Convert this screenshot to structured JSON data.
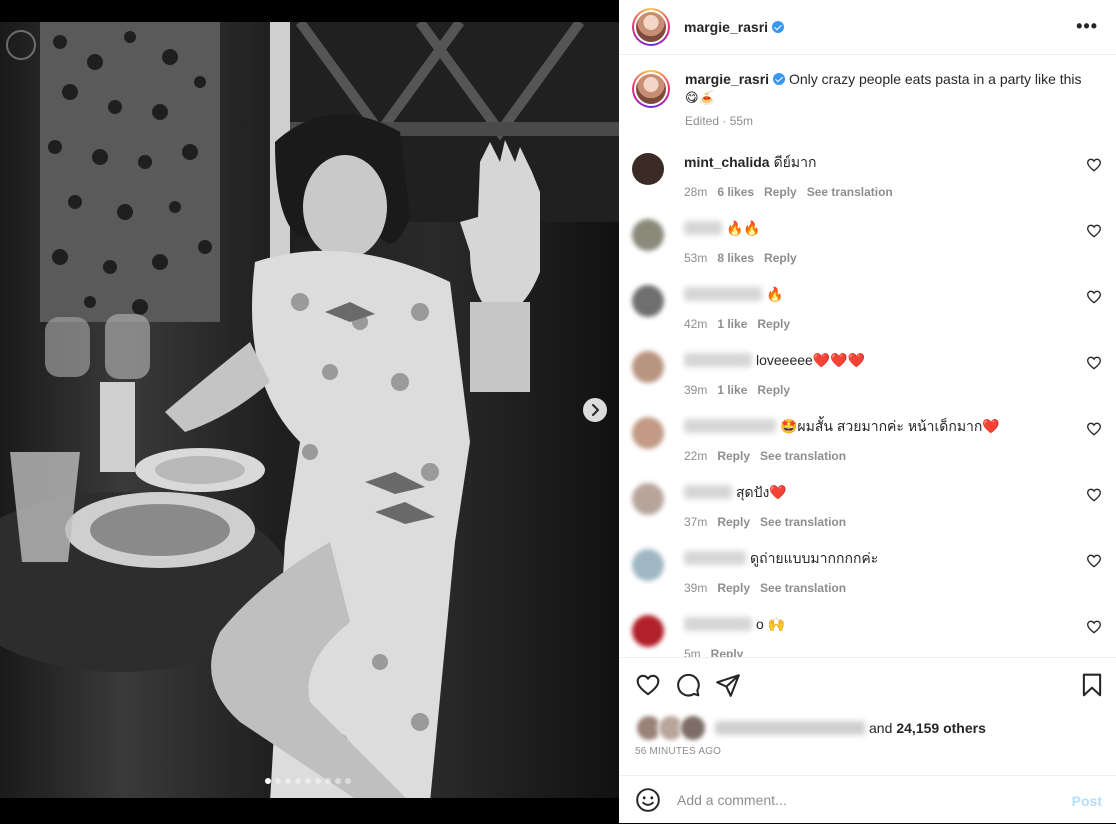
{
  "post": {
    "author": "margie_rasri",
    "caption": "Only crazy people eats pasta in a party like this",
    "caption_emoji": "😋🍝",
    "edited": "Edited · 55m"
  },
  "comments": [
    {
      "user": "mint_chalida",
      "text": "ดีย์มาก",
      "time": "28m",
      "likes": "6 likes",
      "reply": "Reply",
      "translate": "See translation",
      "blur": false,
      "av": "#3b2a25"
    },
    {
      "user": "",
      "text": "🔥🔥",
      "time": "53m",
      "likes": "8 likes",
      "reply": "Reply",
      "translate": "",
      "blur": true,
      "av": "#8a8a7a"
    },
    {
      "user": "",
      "text": "🔥",
      "time": "42m",
      "likes": "1 like",
      "reply": "Reply",
      "translate": "",
      "blur": true,
      "av": "#6f6f6f"
    },
    {
      "user": "",
      "text": "loveeeee❤️❤️❤️",
      "time": "39m",
      "likes": "1 like",
      "reply": "Reply",
      "translate": "",
      "blur": true,
      "av": "#b89581"
    },
    {
      "user": "",
      "text": "🤩ผมสั้น สวยมากค่ะ หน้าเด็กมาก❤️",
      "time": "22m",
      "likes": "",
      "reply": "Reply",
      "translate": "See translation",
      "blur": true,
      "av": "#c29a85"
    },
    {
      "user": "",
      "text": "สุดปัง❤️",
      "time": "37m",
      "likes": "",
      "reply": "Reply",
      "translate": "See translation",
      "blur": true,
      "av": "#b7a59b"
    },
    {
      "user": "",
      "text": "ดูถ่ายแบบมากกกกค่ะ",
      "time": "39m",
      "likes": "",
      "reply": "Reply",
      "translate": "See translation",
      "blur": true,
      "av": "#9fb8c4"
    },
    {
      "user": "",
      "text": "o 🙌",
      "time": "5m",
      "likes": "",
      "reply": "Reply",
      "translate": "",
      "blur": true,
      "av": "#b2202a"
    }
  ],
  "likes_summary": {
    "prefix": "and",
    "count": "24,159 others"
  },
  "timestamp": "56 MINUTES AGO",
  "composer": {
    "placeholder": "Add a comment...",
    "post_label": "Post"
  },
  "carousel": {
    "slides": 9,
    "active": 0
  },
  "icons": {
    "more": "more-horizontal-icon",
    "like": "heart-icon",
    "comment": "comment-icon",
    "share": "share-icon",
    "save": "bookmark-icon",
    "emoji": "smile-icon",
    "next": "chevron-right-icon"
  },
  "colors": {
    "verified": "#3897f0",
    "post_disabled": "#b2dffc",
    "muted": "#8e8e8e"
  }
}
